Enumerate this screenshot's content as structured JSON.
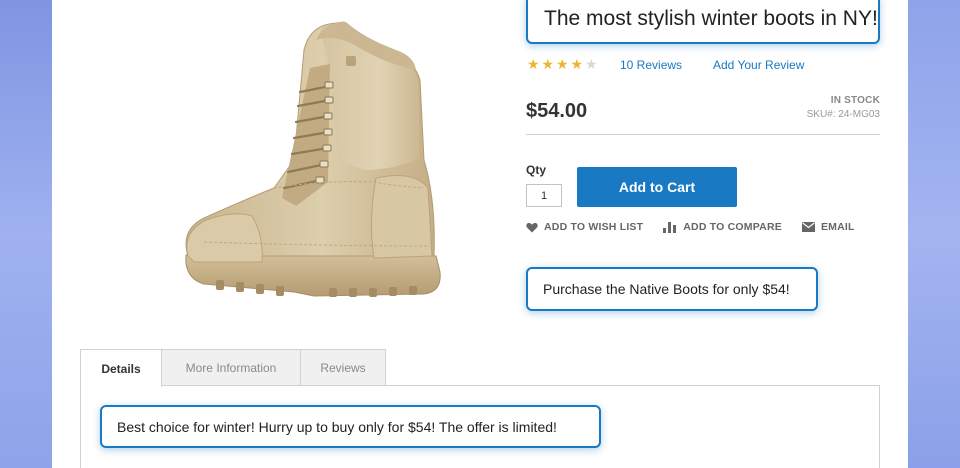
{
  "product": {
    "title": "The most stylish winter boots in NY!",
    "rating_stars": 4,
    "rating_max": 5,
    "reviews_link": "10 Reviews",
    "add_review_link": "Add Your Review",
    "price": "$54.00",
    "stock_status": "IN STOCK",
    "sku": "SKU#: 24-MG03",
    "qty_label": "Qty",
    "qty_value": "1",
    "add_to_cart": "Add to Cart",
    "actions": {
      "wishlist": "ADD TO WISH LIST",
      "compare": "ADD TO COMPARE",
      "email": "EMAIL"
    },
    "promo": "Purchase the Native Boots for only $54!",
    "image_icon": "boot-product-image"
  },
  "tabs": [
    {
      "label": "Details",
      "active": true
    },
    {
      "label": "More Information",
      "active": false
    },
    {
      "label": "Reviews",
      "active": false
    }
  ],
  "details_text": "Best choice for winter! Hurry up to buy only for $54! The offer is limited!",
  "colors": {
    "accent": "#1979c3",
    "star": "#f0b42e",
    "background": "#c6d1f6"
  }
}
